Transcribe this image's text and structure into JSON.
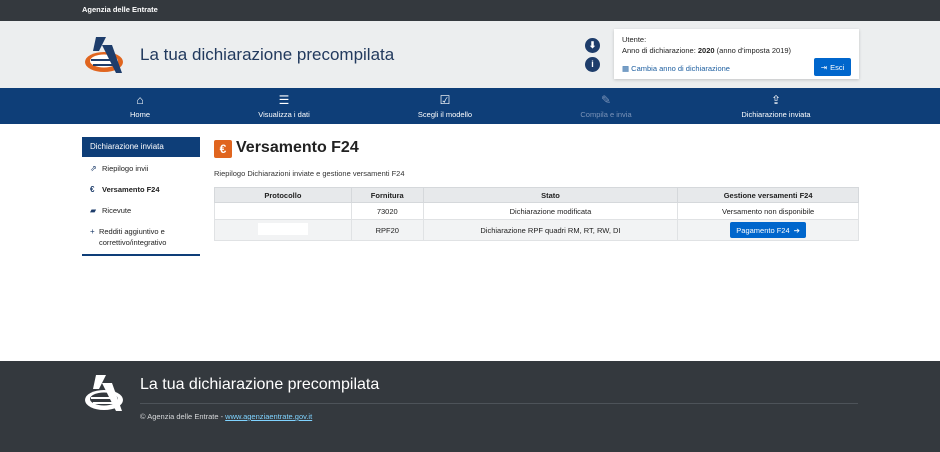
{
  "topbar": {
    "title": "Agenzia delle Entrate"
  },
  "header": {
    "title": "La tua dichiarazione precompilata",
    "user_label": "Utente:",
    "year_prefix": "Anno di dichiarazione: ",
    "year_value": "2020",
    "year_suffix": " (anno d'imposta 2019)",
    "change_year": "Cambia anno di dichiarazione",
    "logout": "Esci"
  },
  "nav": [
    {
      "label": "Home",
      "icon": "home-icon"
    },
    {
      "label": "Visualizza i dati",
      "icon": "list-icon"
    },
    {
      "label": "Scegli il modello",
      "icon": "checkbox-icon"
    },
    {
      "label": "Compila e invia",
      "icon": "edit-icon"
    },
    {
      "label": "Dichiarazione inviata",
      "icon": "share-icon"
    }
  ],
  "sidebar": {
    "heading": "Dichiarazione inviata",
    "items": [
      {
        "label": "Riepilogo invii",
        "icon": "export-icon"
      },
      {
        "label": "Versamento F24",
        "icon": "euro-icon"
      },
      {
        "label": "Ricevute",
        "icon": "folder-icon"
      },
      {
        "label": "Redditi aggiuntivo e correttivo/integrativo",
        "icon": "plus-icon"
      }
    ]
  },
  "main": {
    "title": "Versamento F24",
    "subtitle": "Riepilogo Dichiarazioni inviate e gestione versamenti F24",
    "columns": [
      "Protocollo",
      "Fornitura",
      "Stato",
      "Gestione versamenti F24"
    ],
    "rows": [
      {
        "fornitura": "73020",
        "stato": "Dichiarazione modificata",
        "gestione": "Versamento non disponibile"
      },
      {
        "fornitura": "RPF20",
        "stato": "Dichiarazione RPF quadri RM, RT, RW, DI",
        "gestione": "Pagamento F24"
      }
    ]
  },
  "footer": {
    "title": "La tua dichiarazione precompilata",
    "copyright": "© Agenzia delle Entrate - ",
    "link": "www.agenziaentrate.gov.it"
  },
  "colors": {
    "nav_bg": "#0e3e78",
    "accent_orange": "#e0651f",
    "button_blue": "#0066cc",
    "dark_bar": "#34393e"
  }
}
